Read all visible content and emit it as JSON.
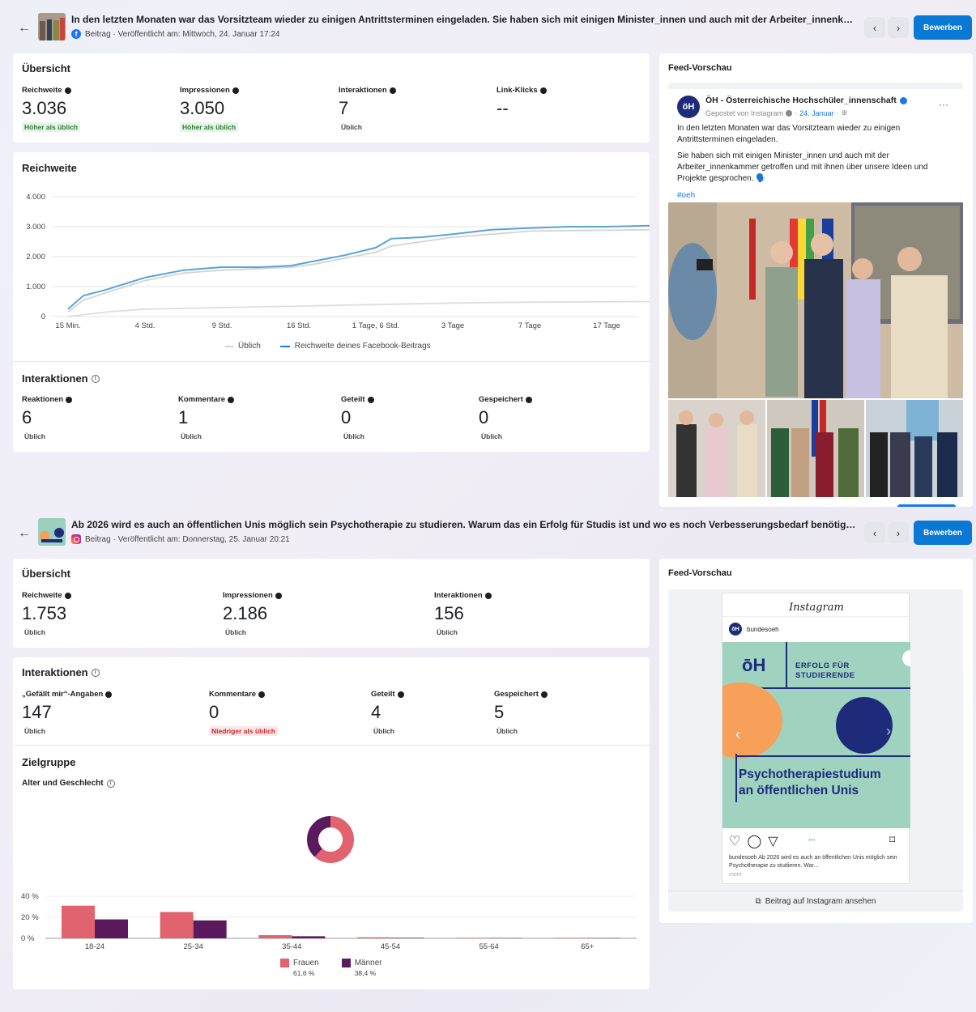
{
  "post1": {
    "title": "In den letzten Monaten war das Vorsitzteam wieder zu einigen Antrittsterminen eingeladen. Sie haben sich mit einigen Minister_innen und auch mit der Arbeiter_innenkammer ...",
    "meta": "Beitrag · Veröffentlicht am: Mittwoch, 24. Januar 17:24",
    "platform_icon": "facebook-icon",
    "boost_label": "Bewerben",
    "overview": {
      "title": "Übersicht",
      "metrics": [
        {
          "label": "Reichweite",
          "value": "3.036",
          "badge": "Höher als üblich"
        },
        {
          "label": "Impressionen",
          "value": "3.050",
          "badge": "Höher als üblich"
        },
        {
          "label": "Interaktionen",
          "value": "7",
          "badge": "Üblich"
        },
        {
          "label": "Link-Klicks",
          "value": "--",
          "badge": ""
        }
      ]
    },
    "reach_chart_title": "Reichweite",
    "interactions": {
      "title": "Interaktionen",
      "metrics": [
        {
          "label": "Reaktionen",
          "value": "6",
          "badge": "Üblich"
        },
        {
          "label": "Kommentare",
          "value": "1",
          "badge": "Üblich"
        },
        {
          "label": "Geteilt",
          "value": "0",
          "badge": "Üblich"
        },
        {
          "label": "Gespeichert",
          "value": "0",
          "badge": "Üblich"
        }
      ]
    },
    "feed": {
      "title": "Feed-Vorschau",
      "page_name": "ÖH - Österreichische Hochschüler_innenschaft",
      "posted_via": "Gepostet von Instagram",
      "date": "24. Januar",
      "text1": "In den letzten Monaten war das Vorsitzteam wieder zu einigen Antrittsterminen eingeladen.",
      "text2": "Sie haben sich mit einigen Minister_innen und auch mit der Arbeiter_innenkammer getroffen und mit ihnen über unsere Ideen und Projekte gesprochen. 🗣️",
      "hashtag": "#oeh",
      "more_icon": "more-icon"
    }
  },
  "post2": {
    "title": "Ab 2026 wird es auch an öffentlichen Unis möglich sein Psychotherapie zu studieren. Warum das ein Erfolg für Studis ist und wo es noch Verbesserungsbedarf benötigt, erfähr...",
    "meta": "Beitrag · Veröffentlicht am: Donnerstag, 25. Januar 20:21",
    "platform_icon": "instagram-icon",
    "boost_label": "Bewerben",
    "overview": {
      "title": "Übersicht",
      "metrics": [
        {
          "label": "Reichweite",
          "value": "1.753",
          "badge": "Üblich"
        },
        {
          "label": "Impressionen",
          "value": "2.186",
          "badge": "Üblich"
        },
        {
          "label": "Interaktionen",
          "value": "156",
          "badge": "Üblich"
        }
      ]
    },
    "interactions": {
      "title": "Interaktionen",
      "metrics": [
        {
          "label": "„Gefällt mir“-Angaben",
          "value": "147",
          "badge": "Üblich"
        },
        {
          "label": "Kommentare",
          "value": "0",
          "badge": "Niedriger als üblich"
        },
        {
          "label": "Geteilt",
          "value": "4",
          "badge": "Üblich"
        },
        {
          "label": "Gespeichert",
          "value": "5",
          "badge": "Üblich"
        }
      ]
    },
    "audience": {
      "title": "Zielgruppe",
      "subtitle": "Alter und Geschlecht",
      "legend": [
        {
          "name": "Frauen",
          "pct": "61,6 %",
          "color": "#e0636f"
        },
        {
          "name": "Männer",
          "pct": "38,4 %",
          "color": "#5c1a5e"
        }
      ]
    },
    "feed": {
      "title": "Feed-Vorschau",
      "ig_brand": "Instagram",
      "account": "bundesoeh",
      "poster_heading_line1": "ERFOLG FÜR",
      "poster_heading_line2": "STUDIERENDE",
      "poster_title_line1": "Psychotherapiestudium",
      "poster_title_line2": "an öffentlichen Unis",
      "logo_text": "ōH",
      "caption": "bundesoeh Ab 2026 wird es auch an öffentlichen Unis möglich sein Psychotherapie zu studieren. War...",
      "more": "more",
      "view_link": "Beitrag auf Instagram ansehen"
    }
  },
  "chart_data": [
    {
      "type": "line",
      "title": "Reichweite",
      "x": [
        "15 Min.",
        "4 Std.",
        "9 Std.",
        "16 Std.",
        "1 Tage, 6 Std.",
        "3 Tage",
        "7 Tage",
        "17 Tage"
      ],
      "ylim": [
        0,
        4000
      ],
      "yticks": [
        "0",
        "1.000",
        "2.000",
        "3.000",
        "4.000"
      ],
      "series": [
        {
          "name": "Reichweite deines Facebook-Beitrags",
          "color": "#5aa3d8",
          "points": [
            [
              0,
              250
            ],
            [
              0.2,
              700
            ],
            [
              0.5,
              900
            ],
            [
              1,
              1300
            ],
            [
              1.5,
              1550
            ],
            [
              2,
              1650
            ],
            [
              2.5,
              1650
            ],
            [
              2.9,
              1700
            ],
            [
              3.2,
              1850
            ],
            [
              3.6,
              2050
            ],
            [
              4,
              2300
            ],
            [
              4.2,
              2600
            ],
            [
              4.6,
              2650
            ],
            [
              5,
              2750
            ],
            [
              5.5,
              2900
            ],
            [
              6,
              2950
            ],
            [
              6.5,
              3000
            ],
            [
              7,
              3000
            ],
            [
              7.6,
              3036
            ]
          ]
        },
        {
          "name": "Üblich",
          "color": "#d3d3d3",
          "points": [
            [
              0,
              150
            ],
            [
              0.2,
              550
            ],
            [
              0.5,
              800
            ],
            [
              1,
              1200
            ],
            [
              1.5,
              1450
            ],
            [
              2,
              1550
            ],
            [
              2.5,
              1600
            ],
            [
              2.9,
              1650
            ],
            [
              3.2,
              1750
            ],
            [
              3.6,
              1950
            ],
            [
              4,
              2150
            ],
            [
              4.2,
              2350
            ],
            [
              4.6,
              2500
            ],
            [
              5,
              2650
            ],
            [
              5.5,
              2750
            ],
            [
              6,
              2850
            ],
            [
              6.5,
              2870
            ],
            [
              7,
              2880
            ],
            [
              7.6,
              2900
            ]
          ]
        },
        {
          "name": "Üblich (untere Linie)",
          "color": "#dedede",
          "points": [
            [
              0,
              0
            ],
            [
              0.5,
              150
            ],
            [
              1,
              250
            ],
            [
              2,
              300
            ],
            [
              3,
              350
            ],
            [
              4,
              400
            ],
            [
              5,
              450
            ],
            [
              6,
              480
            ],
            [
              7.6,
              500
            ]
          ]
        }
      ],
      "legend": [
        "Üblich",
        "Reichweite deines Facebook-Beitrags"
      ]
    },
    {
      "type": "bar",
      "title": "Alter und Geschlecht",
      "categories": [
        "18-24",
        "25-34",
        "35-44",
        "45-54",
        "55-64",
        "65+"
      ],
      "ylim": [
        0,
        40
      ],
      "yticks": [
        "0 %",
        "20 %",
        "40 %"
      ],
      "series": [
        {
          "name": "Frauen",
          "color": "#e0636f",
          "values": [
            31,
            25,
            3,
            1,
            0.5,
            0.5
          ]
        },
        {
          "name": "Männer",
          "color": "#5c1a5e",
          "values": [
            18,
            17,
            2,
            0.5,
            0.3,
            0.3
          ]
        }
      ]
    },
    {
      "type": "pie",
      "title": "",
      "labels": [
        "Frauen",
        "Männer"
      ],
      "values": [
        61.6,
        38.4
      ],
      "colors": [
        "#e0636f",
        "#5c1a5e"
      ]
    }
  ]
}
